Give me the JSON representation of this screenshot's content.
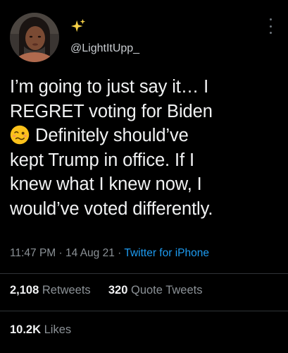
{
  "tweet": {
    "handle": "@LightItUpp_",
    "avatar_icon": "profile-photo",
    "name_icon": "sparkles-icon",
    "more_icon": "more-vertical-icon",
    "body_lines": [
      "I’m going to just say it… I",
      "REGRET voting for Biden",
      "Definitely should’ve",
      "kept Trump in office. If I",
      "knew what I knew now, I",
      "would’ve voted differently."
    ],
    "emoji": "woozy-face-emoji",
    "time": "11:47 PM",
    "date": "14 Aug 21",
    "separator": "·",
    "source": "Twitter for iPhone",
    "colors": {
      "background": "#000000",
      "text": "#e7e9ea",
      "muted": "#8b9196",
      "link": "#1d9bf0",
      "divider": "#2f3336"
    }
  },
  "stats": {
    "retweets_count": "2,108",
    "retweets_label": "Retweets",
    "quotes_count": "320",
    "quotes_label": "Quote Tweets",
    "likes_count": "10.2K",
    "likes_label": "Likes"
  }
}
